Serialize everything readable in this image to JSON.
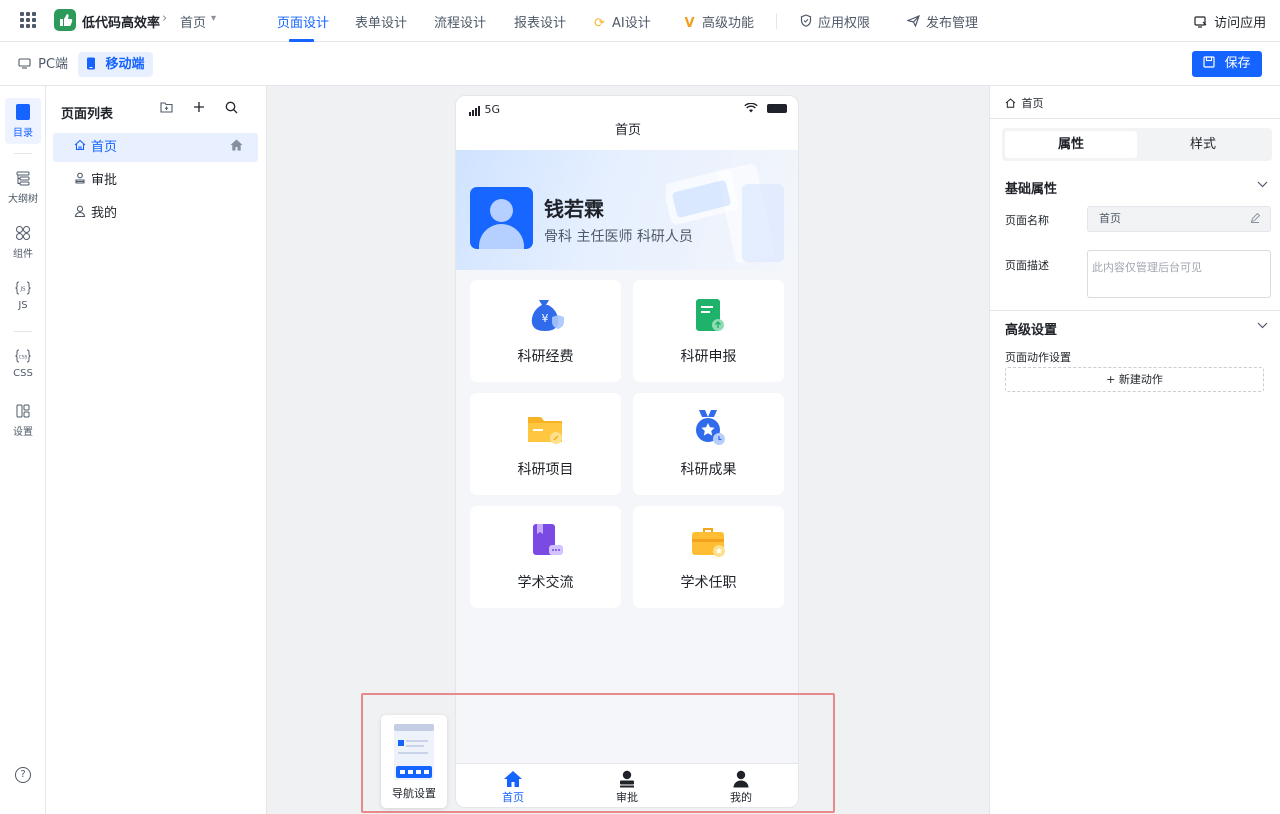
{
  "app": {
    "name": "低代码高效率",
    "logo_icon": "thumbs-up-icon",
    "brand_color": "#1664ff"
  },
  "breadcrumb": {
    "separator": "›",
    "page": "首页",
    "caret": "▾"
  },
  "nav": {
    "tabs": [
      {
        "label": "页面设计",
        "active": true
      },
      {
        "label": "表单设计"
      },
      {
        "label": "流程设计"
      },
      {
        "label": "报表设计"
      },
      {
        "label": "AI设计",
        "icon": "ai-sparkle-icon"
      },
      {
        "label": "高级功能",
        "icon": "advanced-icon"
      },
      {
        "label": "应用权限",
        "icon": "shield-icon"
      },
      {
        "label": "发布管理",
        "icon": "send-icon"
      }
    ],
    "visit_app": "访问应用"
  },
  "toolbar": {
    "pc_label": "PC端",
    "mobile_label": "移动端",
    "save_label": "保存"
  },
  "rail": {
    "items": [
      {
        "label": "目录",
        "icon": "catalog-icon",
        "active": true
      },
      {
        "label": "大纲树",
        "icon": "outline-tree-icon"
      },
      {
        "label": "组件",
        "icon": "components-icon"
      },
      {
        "label": "JS",
        "icon": "js-icon"
      },
      {
        "label": "CSS",
        "icon": "css-icon"
      },
      {
        "label": "设置",
        "icon": "settings-icon"
      }
    ],
    "help_glyph": "?"
  },
  "page_list": {
    "title": "页面列表",
    "items": [
      {
        "label": "首页",
        "icon": "home-icon",
        "active": true,
        "is_home": true
      },
      {
        "label": "审批",
        "icon": "approval-user-icon"
      },
      {
        "label": "我的",
        "icon": "person-icon"
      }
    ]
  },
  "phone": {
    "signal": "5G",
    "title": "首页",
    "profile": {
      "name": "钱若霖",
      "subtitle": "骨科 主任医师 科研人员"
    },
    "cards": [
      {
        "label": "科研经费",
        "icon": "money-bag-icon"
      },
      {
        "label": "科研申报",
        "icon": "document-upload-icon"
      },
      {
        "label": "科研项目",
        "icon": "folder-icon"
      },
      {
        "label": "科研成果",
        "icon": "medal-icon"
      },
      {
        "label": "学术交流",
        "icon": "book-chat-icon"
      },
      {
        "label": "学术任职",
        "icon": "briefcase-star-icon"
      }
    ],
    "tabbar": [
      {
        "label": "首页",
        "icon": "home-icon",
        "active": true
      },
      {
        "label": "审批",
        "icon": "approval-user-icon"
      },
      {
        "label": "我的",
        "icon": "person-icon"
      }
    ]
  },
  "nav_settings": {
    "label": "导航设置"
  },
  "right_panel": {
    "crumb": "首页",
    "tabs": [
      {
        "label": "属性",
        "active": true
      },
      {
        "label": "样式"
      }
    ],
    "basic_section": "基础属性",
    "page_name_label": "页面名称",
    "page_name_value": "首页",
    "page_desc_label": "页面描述",
    "page_desc_placeholder": "此内容仅管理后台可见",
    "advanced_section": "高级设置",
    "action_label": "页面动作设置",
    "new_action": "+ 新建动作"
  }
}
